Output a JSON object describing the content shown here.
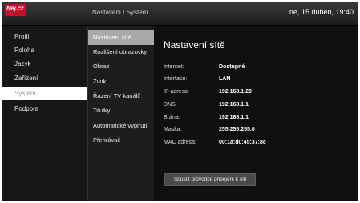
{
  "header": {
    "logo_text": "Nej.cz",
    "breadcrumb": "Nastavení / Systém",
    "datetime": "ne, 15 duben, 19:40"
  },
  "sidebar": {
    "items": [
      {
        "label": "Profil"
      },
      {
        "label": "Poloha"
      },
      {
        "label": "Jazyk"
      },
      {
        "label": "Zařízení"
      },
      {
        "label": "Systém"
      },
      {
        "label": "Podpora"
      }
    ],
    "selected": "Systém"
  },
  "submenu": {
    "items": [
      {
        "label": "Nastavení sítě"
      },
      {
        "label": "Rozlišení obrazovky"
      },
      {
        "label": "Obraz"
      },
      {
        "label": "Zvuk"
      },
      {
        "label": "Řazení TV kanálů"
      },
      {
        "label": "Titulky"
      },
      {
        "label": "Automatické vypnutí"
      },
      {
        "label": "Přehrávač"
      }
    ],
    "active": "Nastavení sítě"
  },
  "network": {
    "title": "Nastavení sítě",
    "rows": [
      {
        "label": "Internet:",
        "value": "Dostupné"
      },
      {
        "label": "Interface:",
        "value": "LAN"
      },
      {
        "label": "IP adresa:",
        "value": "192.168.1.20"
      },
      {
        "label": "DNS:",
        "value": "192.168.1.1"
      },
      {
        "label": "Brána:",
        "value": "192.168.1.1"
      },
      {
        "label": "Maska:",
        "value": "255.255.255.0"
      },
      {
        "label": "MAC adresa:",
        "value": "00:1a:d0:45:37:8c"
      }
    ],
    "wizard_button": "Spustit průvodce připojení k síti"
  },
  "colors": {
    "background": "#0b0b0b",
    "logo_red": "#c8102e",
    "selected_item": "#ffffff",
    "active_submenu": "#a9a9a9"
  }
}
